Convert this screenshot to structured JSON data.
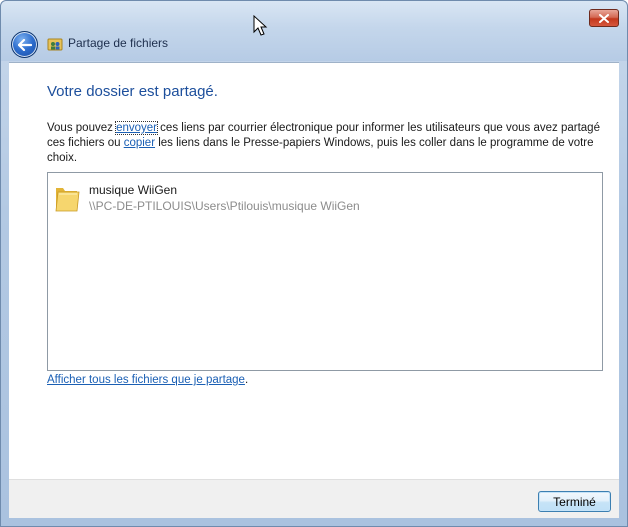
{
  "window": {
    "title": "Partage de fichiers",
    "back_icon": "back-arrow-icon",
    "close_icon": "close-icon"
  },
  "main": {
    "heading": "Votre dossier est partagé.",
    "desc_part1": "Vous pouvez ",
    "link_send": "envoyer",
    "desc_part2": " ces liens par courrier électronique pour informer les utilisateurs que vous avez partagé ces fichiers ou ",
    "link_copy": "copier",
    "desc_part3": " les liens dans le Presse-papiers Windows, puis les coller dans le programme de votre choix."
  },
  "shared_items": [
    {
      "name": "musique WiiGen",
      "path": "\\\\PC-DE-PTILOUIS\\Users\\Ptilouis\\musique WiiGen",
      "icon": "folder-icon"
    }
  ],
  "links": {
    "show_all": "Afficher tous les fichiers que je partage",
    "show_all_suffix": "."
  },
  "footer": {
    "done_label": "Terminé"
  },
  "colors": {
    "heading": "#1d4f9c",
    "link": "#1a5fb4",
    "path": "#8c8c8c"
  }
}
